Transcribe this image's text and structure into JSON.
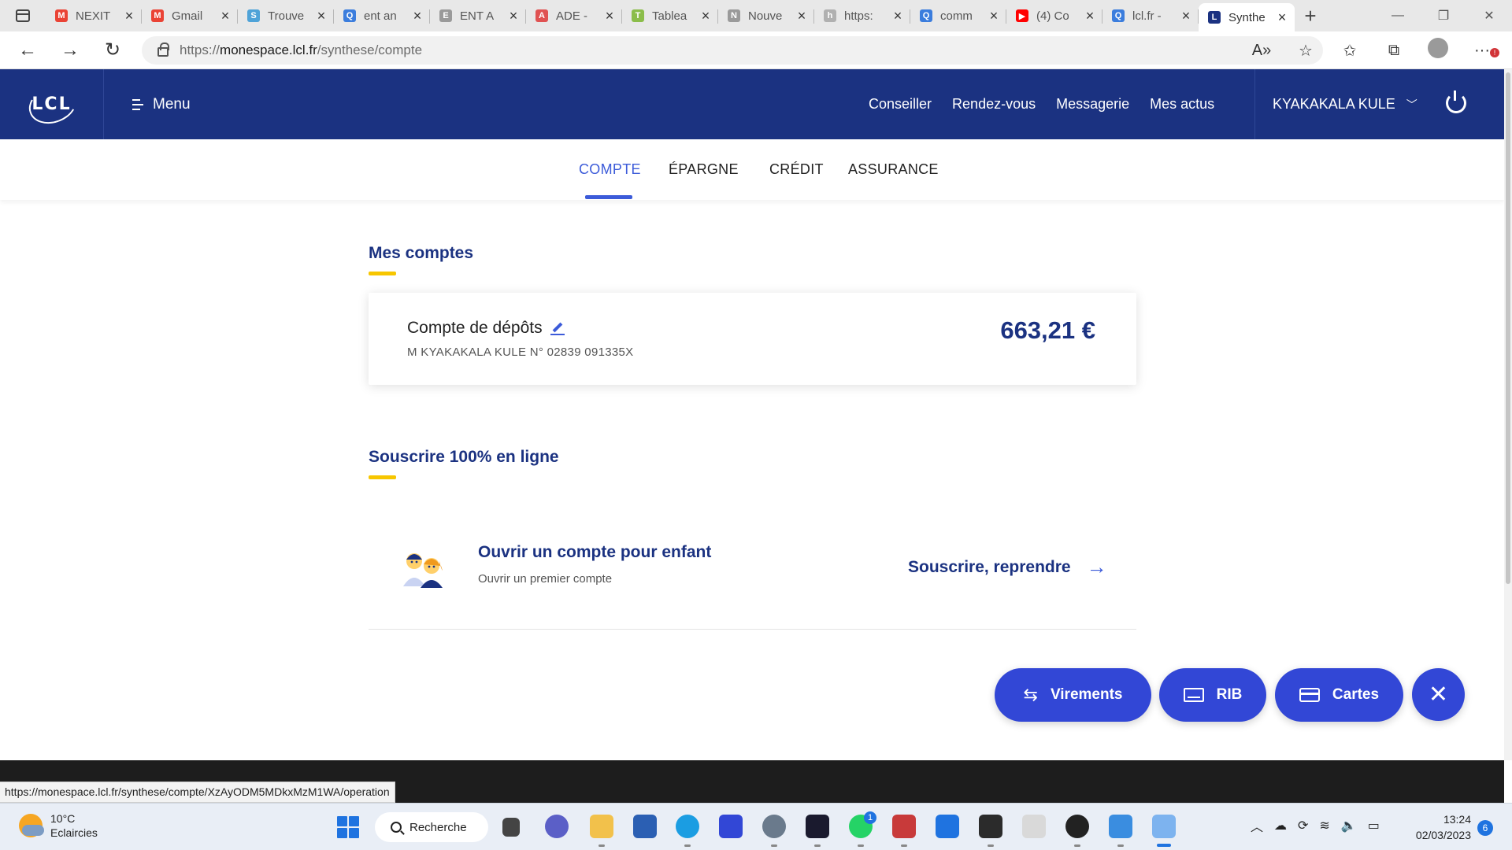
{
  "browser": {
    "tabs": [
      {
        "title": "NEXIT",
        "favicon": "gmail-icon",
        "color": "#ea4335",
        "glyph": "M"
      },
      {
        "title": "Gmail",
        "favicon": "gmail-icon",
        "color": "#ea4335",
        "glyph": "M"
      },
      {
        "title": "Trouve",
        "favicon": "s-icon",
        "color": "#4fa3d8",
        "glyph": "S"
      },
      {
        "title": "ent an",
        "favicon": "search-icon",
        "color": "#3b7ddd",
        "glyph": "Q"
      },
      {
        "title": "ENT A",
        "favicon": "ent-icon",
        "color": "#9a9a9a",
        "glyph": "E"
      },
      {
        "title": "ADE -",
        "favicon": "ade-icon",
        "color": "#e05252",
        "glyph": "A"
      },
      {
        "title": "Tablea",
        "favicon": "tableau-icon",
        "color": "#8bbd4a",
        "glyph": "T"
      },
      {
        "title": "Nouve",
        "favicon": "new-tab-icon",
        "color": "#9a9a9a",
        "glyph": "N"
      },
      {
        "title": "https:",
        "favicon": "page-icon",
        "color": "#b0b0b0",
        "glyph": "h"
      },
      {
        "title": "comm",
        "favicon": "search-icon",
        "color": "#3b7ddd",
        "glyph": "Q"
      },
      {
        "title": "(4) Co",
        "favicon": "youtube-icon",
        "color": "#ff0000",
        "glyph": "▶"
      },
      {
        "title": "lcl.fr -",
        "favicon": "search-icon",
        "color": "#3b7ddd",
        "glyph": "Q"
      },
      {
        "title": "Synthe",
        "favicon": "lcl-icon",
        "color": "#1b3281",
        "glyph": "L"
      }
    ],
    "url_pre": "https://",
    "url_host": "monespace.lcl.fr",
    "url_path": "/synthese/compte",
    "status_url": "https://monespace.lcl.fr/synthese/compte/XzAyODM5MDkxMzM1WA/operation"
  },
  "header": {
    "menu_label": "Menu",
    "links": [
      "Conseiller",
      "Rendez-vous",
      "Messagerie",
      "Mes actus"
    ],
    "user_name": "KYAKAKALA KULE",
    "brand_color": "#1b3281"
  },
  "subnav": {
    "items": [
      "COMPTE",
      "ÉPARGNE",
      "CRÉDIT",
      "ASSURANCE"
    ],
    "active": "COMPTE"
  },
  "accounts": {
    "title": "Mes comptes",
    "account_name": "Compte de dépôts",
    "account_number": "M KYAKAKALA KULE N° 02839 091335X",
    "balance": "663,21 €"
  },
  "subscribe": {
    "title": "Souscrire 100% en ligne",
    "offer_title": "Ouvrir un compte pour enfant",
    "offer_subtitle": "Ouvrir un premier compte",
    "cta": "Souscrire, reprendre"
  },
  "actions": {
    "virements": "Virements",
    "rib": "RIB",
    "cartes": "Cartes",
    "accent": "#3247d6"
  },
  "taskbar": {
    "temperature": "10°C",
    "weather": "Eclaircies",
    "search": "Recherche",
    "time": "13:24",
    "date": "02/03/2023",
    "notifications": "6",
    "whatsapp_badge": "1"
  }
}
